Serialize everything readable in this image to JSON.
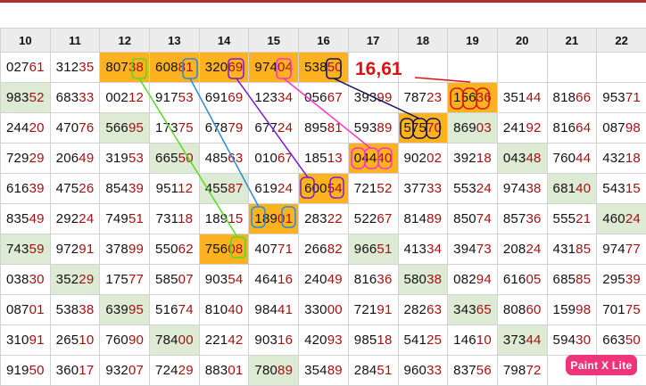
{
  "columns": [
    "10",
    "11",
    "12",
    "13",
    "14",
    "15",
    "16",
    "17",
    "18",
    "19",
    "20",
    "21",
    "22"
  ],
  "rows": [
    [
      [
        "027",
        "61",
        "w"
      ],
      [
        "312",
        "35",
        "w"
      ],
      [
        "807",
        "38",
        "o"
      ],
      [
        "608",
        "81",
        "o"
      ],
      [
        "320",
        "69",
        "o"
      ],
      [
        "974",
        "04",
        "o"
      ],
      [
        "538",
        "50",
        "o"
      ],
      [
        "",
        "",
        ""
      ],
      [
        "",
        "",
        ""
      ],
      [
        "",
        "",
        ""
      ],
      [
        "",
        "",
        ""
      ],
      [
        "",
        "",
        ""
      ],
      [
        "",
        "",
        ""
      ]
    ],
    [
      [
        "983",
        "52",
        "g"
      ],
      [
        "683",
        "33",
        "w"
      ],
      [
        "002",
        "12",
        "w"
      ],
      [
        "917",
        "53",
        "w"
      ],
      [
        "691",
        "69",
        "w"
      ],
      [
        "123",
        "34",
        "w"
      ],
      [
        "056",
        "67",
        "w"
      ],
      [
        "393",
        "99",
        "w"
      ],
      [
        "787",
        "23",
        "w"
      ],
      [
        "156",
        "36",
        "o"
      ],
      [
        "351",
        "44",
        "w"
      ],
      [
        "818",
        "66",
        "w"
      ],
      [
        "953",
        "71",
        "w"
      ]
    ],
    [
      [
        "244",
        "20",
        "w"
      ],
      [
        "470",
        "76",
        "w"
      ],
      [
        "566",
        "95",
        "g"
      ],
      [
        "173",
        "75",
        "w"
      ],
      [
        "678",
        "79",
        "w"
      ],
      [
        "677",
        "24",
        "w"
      ],
      [
        "895",
        "81",
        "w"
      ],
      [
        "593",
        "89",
        "w"
      ],
      [
        "575",
        "70",
        "o"
      ],
      [
        "869",
        "03",
        "g"
      ],
      [
        "241",
        "92",
        "w"
      ],
      [
        "816",
        "64",
        "w"
      ],
      [
        "087",
        "98",
        "w"
      ]
    ],
    [
      [
        "729",
        "29",
        "w"
      ],
      [
        "206",
        "49",
        "w"
      ],
      [
        "319",
        "53",
        "w"
      ],
      [
        "665",
        "50",
        "g"
      ],
      [
        "485",
        "63",
        "w"
      ],
      [
        "010",
        "67",
        "w"
      ],
      [
        "185",
        "13",
        "w"
      ],
      [
        "044",
        "40",
        "o"
      ],
      [
        "902",
        "02",
        "w"
      ],
      [
        "392",
        "18",
        "w"
      ],
      [
        "043",
        "48",
        "g"
      ],
      [
        "760",
        "44",
        "w"
      ],
      [
        "432",
        "18",
        "w"
      ]
    ],
    [
      [
        "616",
        "39",
        "w"
      ],
      [
        "475",
        "26",
        "w"
      ],
      [
        "854",
        "39",
        "w"
      ],
      [
        "951",
        "12",
        "w"
      ],
      [
        "455",
        "87",
        "g"
      ],
      [
        "619",
        "24",
        "w"
      ],
      [
        "600",
        "54",
        "o"
      ],
      [
        "721",
        "52",
        "w"
      ],
      [
        "377",
        "33",
        "w"
      ],
      [
        "553",
        "24",
        "w"
      ],
      [
        "974",
        "38",
        "w"
      ],
      [
        "681",
        "40",
        "g"
      ],
      [
        "543",
        "15",
        "w"
      ]
    ],
    [
      [
        "835",
        "49",
        "w"
      ],
      [
        "292",
        "24",
        "w"
      ],
      [
        "749",
        "51",
        "w"
      ],
      [
        "731",
        "18",
        "w"
      ],
      [
        "189",
        "15",
        "w"
      ],
      [
        "189",
        "01",
        "o"
      ],
      [
        "283",
        "22",
        "w"
      ],
      [
        "522",
        "67",
        "w"
      ],
      [
        "814",
        "89",
        "w"
      ],
      [
        "850",
        "74",
        "w"
      ],
      [
        "857",
        "36",
        "w"
      ],
      [
        "555",
        "21",
        "w"
      ],
      [
        "460",
        "24",
        "g"
      ]
    ],
    [
      [
        "743",
        "59",
        "g"
      ],
      [
        "972",
        "91",
        "w"
      ],
      [
        "378",
        "99",
        "w"
      ],
      [
        "550",
        "62",
        "w"
      ],
      [
        "756",
        "08",
        "o"
      ],
      [
        "407",
        "71",
        "w"
      ],
      [
        "266",
        "82",
        "w"
      ],
      [
        "966",
        "51",
        "g"
      ],
      [
        "413",
        "34",
        "w"
      ],
      [
        "394",
        "73",
        "w"
      ],
      [
        "208",
        "24",
        "w"
      ],
      [
        "431",
        "85",
        "w"
      ],
      [
        "974",
        "77",
        "w"
      ]
    ],
    [
      [
        "038",
        "30",
        "w"
      ],
      [
        "352",
        "29",
        "g"
      ],
      [
        "175",
        "77",
        "w"
      ],
      [
        "585",
        "07",
        "w"
      ],
      [
        "903",
        "54",
        "w"
      ],
      [
        "464",
        "16",
        "w"
      ],
      [
        "240",
        "49",
        "w"
      ],
      [
        "816",
        "36",
        "w"
      ],
      [
        "580",
        "38",
        "g"
      ],
      [
        "082",
        "94",
        "w"
      ],
      [
        "616",
        "05",
        "w"
      ],
      [
        "685",
        "85",
        "w"
      ],
      [
        "295",
        "39",
        "w"
      ]
    ],
    [
      [
        "087",
        "01",
        "w"
      ],
      [
        "538",
        "38",
        "w"
      ],
      [
        "639",
        "95",
        "g"
      ],
      [
        "516",
        "74",
        "w"
      ],
      [
        "810",
        "40",
        "w"
      ],
      [
        "984",
        "41",
        "w"
      ],
      [
        "330",
        "00",
        "w"
      ],
      [
        "721",
        "91",
        "w"
      ],
      [
        "282",
        "63",
        "w"
      ],
      [
        "343",
        "65",
        "g"
      ],
      [
        "808",
        "60",
        "w"
      ],
      [
        "159",
        "98",
        "w"
      ],
      [
        "701",
        "75",
        "w"
      ]
    ],
    [
      [
        "310",
        "91",
        "w"
      ],
      [
        "265",
        "10",
        "w"
      ],
      [
        "760",
        "90",
        "w"
      ],
      [
        "784",
        "00",
        "g"
      ],
      [
        "221",
        "42",
        "w"
      ],
      [
        "903",
        "16",
        "w"
      ],
      [
        "420",
        "93",
        "w"
      ],
      [
        "985",
        "18",
        "w"
      ],
      [
        "541",
        "25",
        "w"
      ],
      [
        "146",
        "10",
        "w"
      ],
      [
        "373",
        "44",
        "g"
      ],
      [
        "594",
        "30",
        "w"
      ],
      [
        "663",
        "50",
        "w"
      ]
    ],
    [
      [
        "919",
        "50",
        "w"
      ],
      [
        "360",
        "17",
        "w"
      ],
      [
        "932",
        "07",
        "w"
      ],
      [
        "724",
        "29",
        "w"
      ],
      [
        "883",
        "01",
        "w"
      ],
      [
        "780",
        "89",
        "g"
      ],
      [
        "354",
        "89",
        "w"
      ],
      [
        "284",
        "51",
        "w"
      ],
      [
        "960",
        "33",
        "w"
      ],
      [
        "837",
        "56",
        "w"
      ],
      [
        "798",
        "72",
        "w"
      ],
      [
        "",
        "",
        ""
      ],
      [
        "",
        "",
        ""
      ]
    ]
  ],
  "annotation": {
    "label": "16,61",
    "color": "#e01010"
  },
  "badge": {
    "label": "Paint X Lite"
  }
}
